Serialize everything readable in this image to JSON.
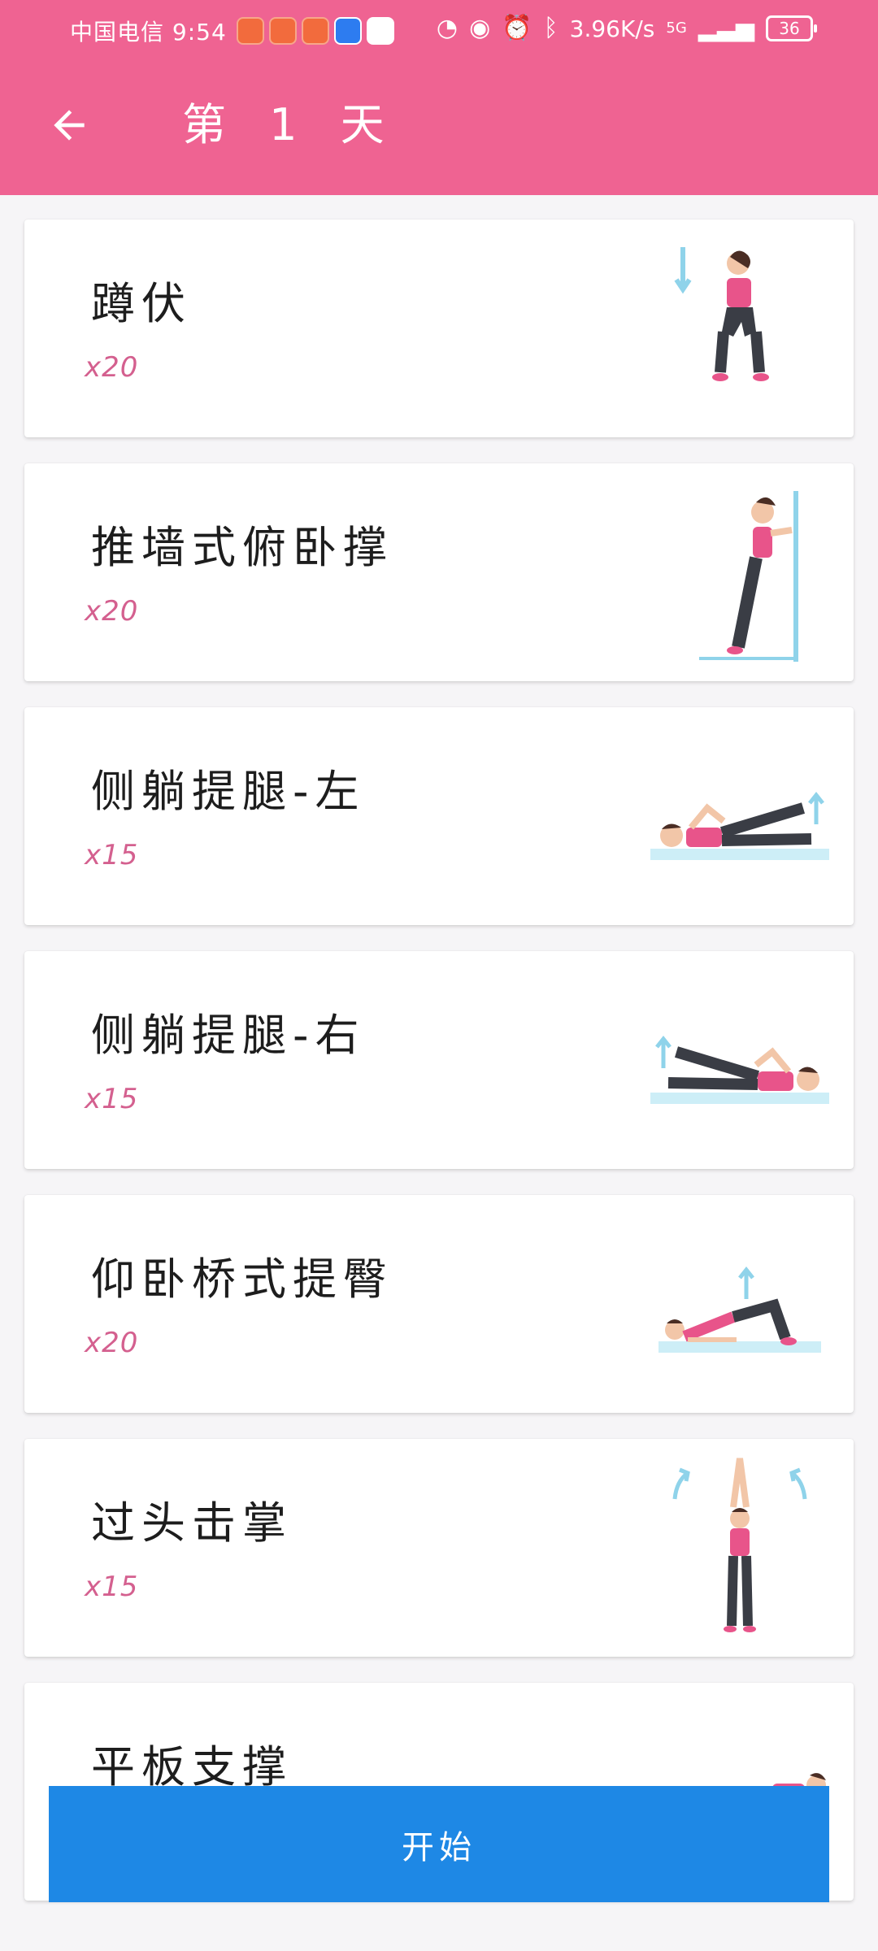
{
  "status_bar": {
    "carrier_time": "中国电信 9:54",
    "speed": "3.96K/s",
    "network": "5G",
    "battery": "36"
  },
  "app_bar": {
    "title": "第 1 天",
    "back_icon": "arrow-left-icon"
  },
  "exercises": [
    {
      "name": "蹲伏",
      "reps": "x20",
      "illustration": "squat-figure"
    },
    {
      "name": "推墙式俯卧撑",
      "reps": "x20",
      "illustration": "wall-pushup-figure"
    },
    {
      "name": "侧躺提腿-左",
      "reps": "x15",
      "illustration": "side-leg-lift-left-figure"
    },
    {
      "name": "侧躺提腿-右",
      "reps": "x15",
      "illustration": "side-leg-lift-right-figure"
    },
    {
      "name": "仰卧桥式提臀",
      "reps": "x20",
      "illustration": "glute-bridge-figure"
    },
    {
      "name": "过头击掌",
      "reps": "x15",
      "illustration": "overhead-clap-figure"
    },
    {
      "name": "平板支撑",
      "reps": "",
      "illustration": "plank-figure"
    }
  ],
  "start_button": {
    "label": "开始"
  },
  "colors": {
    "primary": "#ef6392",
    "accent": "#d4608f",
    "button": "#1e88e5"
  }
}
